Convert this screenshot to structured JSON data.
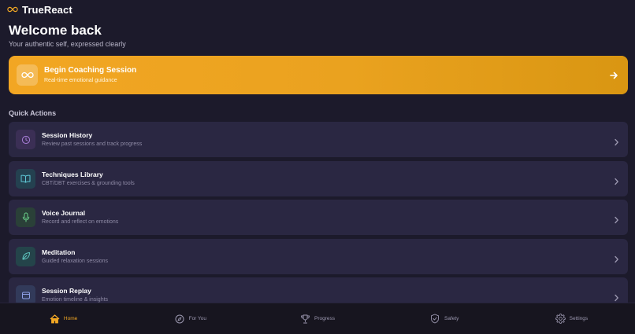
{
  "app": {
    "name": "TrueReact"
  },
  "welcome": {
    "title": "Welcome back",
    "subtitle": "Your authentic self, expressed clearly"
  },
  "hero": {
    "title": "Begin Coaching Session",
    "subtitle": "Real-time emotional guidance",
    "icon": "infinity-icon",
    "accent": "#f2a623"
  },
  "quick_actions": {
    "title": "Quick Actions",
    "items": [
      {
        "title": "Session History",
        "description": "Review past sessions and track progress",
        "icon": "clock-icon",
        "color": "#a77dd6",
        "bg": "#3b2f55"
      },
      {
        "title": "Techniques Library",
        "description": "CBT/DBT exercises & grounding tools",
        "icon": "book-icon",
        "color": "#5fc7d6",
        "bg": "#244150"
      },
      {
        "title": "Voice Journal",
        "description": "Record and reflect on emotions",
        "icon": "microphone-icon",
        "color": "#6ad08a",
        "bg": "#2a4038"
      },
      {
        "title": "Meditation",
        "description": "Guided relaxation sessions",
        "icon": "leaf-icon",
        "color": "#5fc7c0",
        "bg": "#24444a"
      },
      {
        "title": "Session Replay",
        "description": "Emotion timeline & insights",
        "icon": "film-icon",
        "color": "#8ea0e6",
        "bg": "#323a5a"
      }
    ]
  },
  "nav": {
    "items": [
      {
        "label": "Home",
        "icon": "home-icon",
        "active": true
      },
      {
        "label": "For You",
        "icon": "compass-icon",
        "active": false
      },
      {
        "label": "Progress",
        "icon": "trophy-icon",
        "active": false
      },
      {
        "label": "Safety",
        "icon": "shield-icon",
        "active": false
      },
      {
        "label": "Settings",
        "icon": "gear-icon",
        "active": false
      }
    ]
  },
  "colors": {
    "background": "#1c1a2b",
    "card": "#2a2742",
    "accent": "#f3a824",
    "nav_background": "#17151f"
  }
}
